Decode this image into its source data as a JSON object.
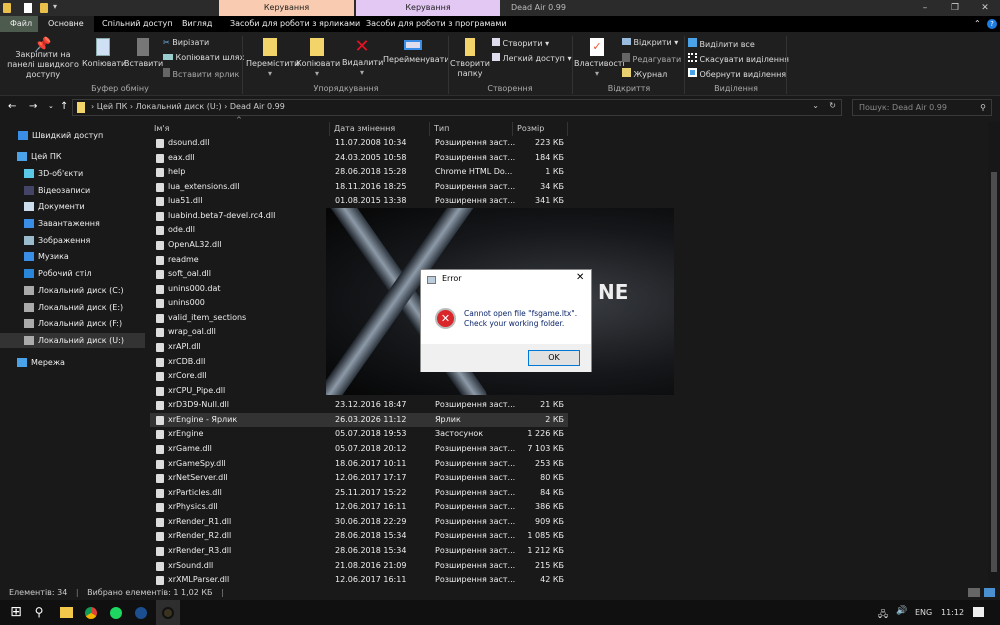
{
  "window": {
    "title": "Dead Air 0.99",
    "context_tabs": [
      {
        "label": "Керування",
        "color": "#f9cbb0"
      },
      {
        "label": "Керування",
        "color": "#e4c8f4"
      }
    ]
  },
  "tabs": [
    "Файл",
    "Основне",
    "Спільний доступ",
    "Вигляд",
    "Засоби для роботи з ярликами",
    "Засоби для роботи з програмами"
  ],
  "ribbon": {
    "pin": "Закріпити на панелі швидкого доступу",
    "copy": "Копіювати",
    "paste": "Вставити",
    "cut": "Вирізати",
    "copy_path": "Копіювати шлях",
    "paste_shortcut": "Вставити ярлик",
    "move": "Перемістити",
    "copy_to": "Копіювати",
    "delete": "Видалити",
    "rename": "Перейменувати",
    "new_folder": "Створити папку",
    "new_item": "Створити",
    "easy_access": "Легкий доступ",
    "properties": "Властивості",
    "open": "Відкрити",
    "edit": "Редагувати",
    "history": "Журнал",
    "select_all": "Виділити все",
    "select_none": "Скасувати виділення",
    "invert": "Обернути виділення",
    "groups": [
      "Буфер обміну",
      "Упорядкування",
      "Створення",
      "Відкриття",
      "Виділення"
    ]
  },
  "address": {
    "crumbs": [
      "Цей ПК",
      "Локальний диск (U:)",
      "Dead Air 0.99"
    ],
    "search_placeholder": "Пошук: Dead Air 0.99"
  },
  "sidebar": [
    "Швидкий доступ",
    "Цей ПК",
    "3D-об'єкти",
    "Відеозаписи",
    "Документи",
    "Завантаження",
    "Зображення",
    "Музика",
    "Робочий стіл",
    "Локальний диск (C:)",
    "Локальний диск (E:)",
    "Локальний диск (F:)",
    "Локальний диск (U:)",
    "Мережа"
  ],
  "columns": [
    "Ім'я",
    "Дата змінення",
    "Тип",
    "Розмір"
  ],
  "files": [
    {
      "name": "dsound.dll",
      "date": "11.07.2008 10:34",
      "type": "Розширення заст...",
      "size": "223 КБ"
    },
    {
      "name": "eax.dll",
      "date": "24.03.2005 10:58",
      "type": "Розширення заст...",
      "size": "184 КБ"
    },
    {
      "name": "help",
      "date": "28.06.2018 15:28",
      "type": "Chrome HTML Do...",
      "size": "1 КБ"
    },
    {
      "name": "lua_extensions.dll",
      "date": "18.11.2016 18:25",
      "type": "Розширення заст...",
      "size": "34 КБ"
    },
    {
      "name": "lua51.dll",
      "date": "01.08.2015 13:38",
      "type": "Розширення заст...",
      "size": "341 КБ"
    },
    {
      "name": "luabind.beta7-devel.rc4.dll"
    },
    {
      "name": "ode.dll"
    },
    {
      "name": "OpenAL32.dll"
    },
    {
      "name": "readme"
    },
    {
      "name": "soft_oal.dll"
    },
    {
      "name": "unins000.dat"
    },
    {
      "name": "unins000"
    },
    {
      "name": "valid_item_sections"
    },
    {
      "name": "wrap_oal.dll"
    },
    {
      "name": "xrAPI.dll"
    },
    {
      "name": "xrCDB.dll"
    },
    {
      "name": "xrCore.dll"
    },
    {
      "name": "xrCPU_Pipe.dll"
    },
    {
      "name": "xrD3D9-Null.dll",
      "date": "23.12.2016 18:47",
      "type": "Розширення заст...",
      "size": "21 КБ"
    },
    {
      "name": "xrEngine - Ярлик",
      "date": "26.03.2026 11:12",
      "type": "Ярлик",
      "size": "2 КБ",
      "selected": true
    },
    {
      "name": "xrEngine",
      "date": "05.07.2018 19:53",
      "type": "Застосунок",
      "size": "1 226 КБ"
    },
    {
      "name": "xrGame.dll",
      "date": "05.07.2018 20:12",
      "type": "Розширення заст...",
      "size": "7 103 КБ"
    },
    {
      "name": "xrGameSpy.dll",
      "date": "18.06.2017 10:11",
      "type": "Розширення заст...",
      "size": "253 КБ"
    },
    {
      "name": "xrNetServer.dll",
      "date": "12.06.2017 17:17",
      "type": "Розширення заст...",
      "size": "80 КБ"
    },
    {
      "name": "xrParticles.dll",
      "date": "25.11.2017 15:22",
      "type": "Розширення заст...",
      "size": "84 КБ"
    },
    {
      "name": "xrPhysics.dll",
      "date": "12.06.2017 16:11",
      "type": "Розширення заст...",
      "size": "386 КБ"
    },
    {
      "name": "xrRender_R1.dll",
      "date": "30.06.2018 22:29",
      "type": "Розширення заст...",
      "size": "909 КБ"
    },
    {
      "name": "xrRender_R2.dll",
      "date": "28.06.2018 15:34",
      "type": "Розширення заст...",
      "size": "1 085 КБ"
    },
    {
      "name": "xrRender_R3.dll",
      "date": "28.06.2018 15:34",
      "type": "Розширення заст...",
      "size": "1 212 КБ"
    },
    {
      "name": "xrSound.dll",
      "date": "21.08.2016 21:09",
      "type": "Розширення заст...",
      "size": "215 КБ"
    },
    {
      "name": "xrXMLParser.dll",
      "date": "12.06.2017 16:11",
      "type": "Розширення заст...",
      "size": "42 КБ"
    }
  ],
  "splash": {
    "logo_fragment": "NE"
  },
  "dialog": {
    "title": "Error",
    "message_line1": "Cannot open file \"fsgame.ltx\".",
    "message_line2": "Check your working folder.",
    "ok": "OK"
  },
  "status": {
    "count": "Елементів: 34",
    "selected": "Вибрано елементів: 1  1,02 КБ"
  },
  "taskbar": {
    "lang": "ENG",
    "time": "11:12"
  }
}
